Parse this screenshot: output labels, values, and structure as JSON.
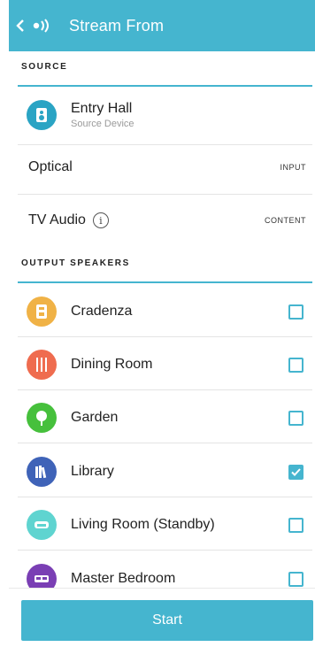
{
  "header": {
    "title": "Stream From",
    "back_icon": "chevron-left-icon",
    "speaker_icon": "speaker-sound-icon"
  },
  "source_section": {
    "label": "SOURCE",
    "device": {
      "name": "Entry Hall",
      "subtitle": "Source Device",
      "icon": "speaker-device-icon",
      "color": "#2aa4c4"
    },
    "input": {
      "name": "Optical",
      "tag": "INPUT"
    },
    "content": {
      "name": "TV Audio",
      "tag": "CONTENT",
      "icon": "info-icon"
    }
  },
  "output_section": {
    "label": "OUTPUT SPEAKERS",
    "speakers": [
      {
        "name": "Cradenza",
        "checked": false,
        "icon": "speaker-device-icon",
        "color": "#f0b246"
      },
      {
        "name": "Dining Room",
        "checked": false,
        "icon": "dining-utensils-icon",
        "color": "#ef6c4f"
      },
      {
        "name": "Garden",
        "checked": false,
        "icon": "tree-icon",
        "color": "#46c03c"
      },
      {
        "name": "Library",
        "checked": true,
        "icon": "books-icon",
        "color": "#3f63b8"
      },
      {
        "name": "Living Room (Standby)",
        "checked": false,
        "icon": "sofa-icon",
        "color": "#5fd4d0"
      },
      {
        "name": "Master Bedroom",
        "checked": false,
        "icon": "bed-icon",
        "color": "#7a3fb4"
      }
    ]
  },
  "footer": {
    "start_label": "Start"
  },
  "colors": {
    "accent": "#45b5cf"
  }
}
